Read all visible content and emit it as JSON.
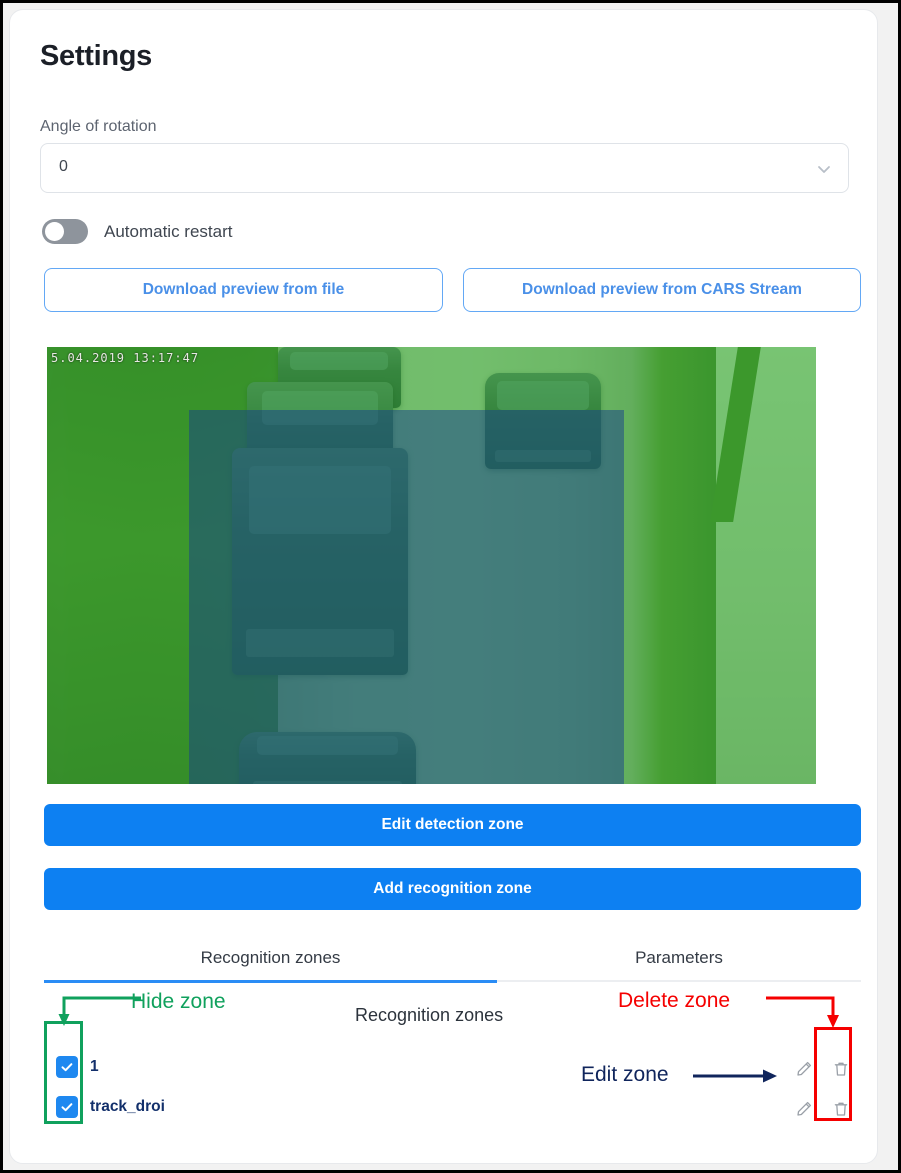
{
  "page": {
    "title": "Settings"
  },
  "form": {
    "angle_label": "Angle of rotation",
    "angle_value": "0",
    "angle_placeholder": "0",
    "chevron_icon": "chevron-down-icon",
    "automatic_restart_label": "Automatic restart",
    "automatic_restart_state": "off"
  },
  "actions": {
    "download_from_file": "Download preview from file",
    "download_from_stream": "Download preview from CARS Stream",
    "edit_detection_zone": "Edit detection zone",
    "add_recognition_zone": "Add recognition zone"
  },
  "preview": {
    "timestamp": "5.04.2019  13:17:47",
    "detection_zone_color": "#31be31",
    "recognition_zone_color": "#163e8c"
  },
  "tabs": [
    {
      "label": "Recognition zones",
      "active": true
    },
    {
      "label": "Parameters",
      "active": false
    }
  ],
  "list": {
    "header": "Recognition zones",
    "rows": [
      {
        "name": "1",
        "visible": true,
        "edit_icon": "pencil-icon",
        "delete_icon": "trash-icon"
      },
      {
        "name": "track_droi",
        "visible": true,
        "edit_icon": "pencil-icon",
        "delete_icon": "trash-icon"
      }
    ]
  },
  "annotations": [
    {
      "label": "Hide zone",
      "color": "#10a15d"
    },
    {
      "label": "Edit zone",
      "color": "#10255c"
    },
    {
      "label": "Delete zone",
      "color": "#f50000"
    }
  ],
  "colors": {
    "primary": "#0d80f2",
    "outline_blue": "#4a90e8",
    "checkbox_blue": "#1e88f0",
    "tab_active": "#2a8cf5",
    "zone_name": "#13306b"
  }
}
